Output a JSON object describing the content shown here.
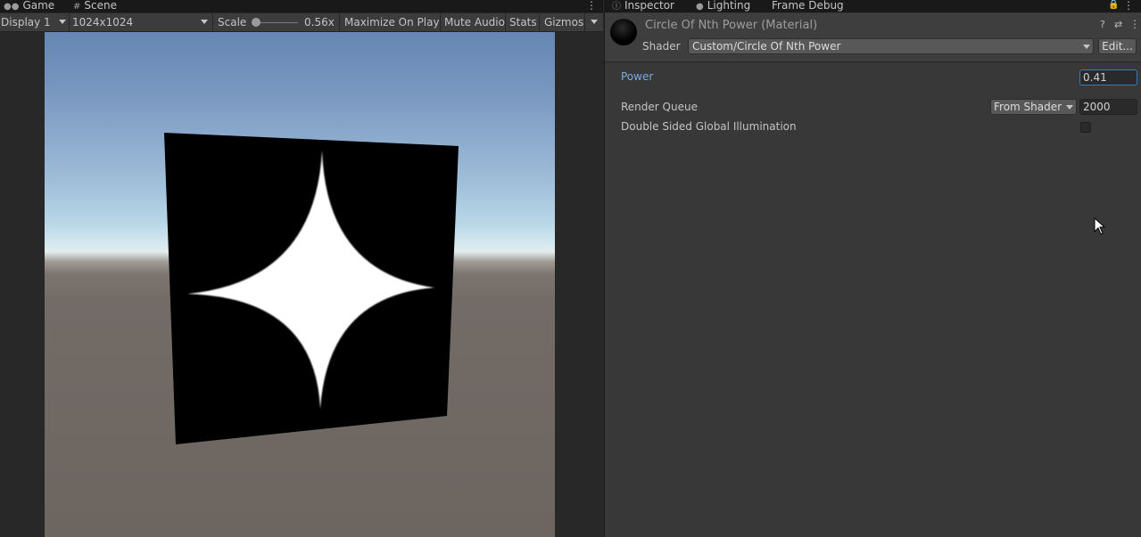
{
  "left_panel": {
    "tabs": [
      {
        "label": "Game",
        "icon": "gamepad-icon"
      },
      {
        "label": "Scene",
        "icon": "grid-icon"
      }
    ],
    "toolbar": {
      "display": "Display 1",
      "resolution": "1024x1024",
      "scale_label": "Scale",
      "scale_value": "0.56x",
      "maximize_on_play": "Maximize On Play",
      "mute_audio": "Mute Audio",
      "stats": "Stats",
      "gizmos": "Gizmos"
    },
    "game_view": {
      "sky_color_top": "#6686b3",
      "horizon_color": "#e3eceb",
      "ground_color": "#6c6560",
      "quad_color": "#000000",
      "star_color": "#ffffff"
    }
  },
  "right_panel": {
    "tabs": [
      {
        "label": "Inspector",
        "icon": "info-icon"
      },
      {
        "label": "Lighting",
        "icon": "lightbulb-icon"
      },
      {
        "label": "Frame Debug",
        "icon": ""
      }
    ],
    "material": {
      "title": "Circle Of Nth Power (Material)",
      "shader_label": "Shader",
      "shader_value": "Custom/Circle Of Nth Power",
      "edit_button": "Edit..."
    },
    "properties": {
      "power_label": "Power",
      "power_value": "0.41",
      "render_queue_label": "Render Queue",
      "render_queue_mode": "From Shader",
      "render_queue_value": "2000",
      "double_sided_gi_label": "Double Sided Global Illumination",
      "double_sided_gi_checked": false
    },
    "accent_color": "#7babe1"
  }
}
